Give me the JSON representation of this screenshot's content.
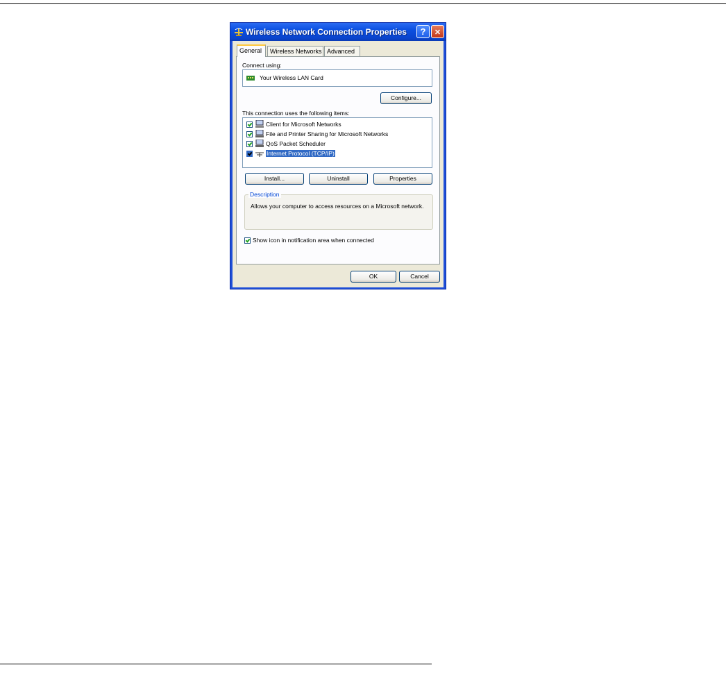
{
  "window": {
    "title": "Wireless Network Connection Properties",
    "help_glyph": "?",
    "close_glyph": "✕"
  },
  "tabs": [
    {
      "label": "General",
      "active": true
    },
    {
      "label": "Wireless Networks",
      "active": false
    },
    {
      "label": "Advanced",
      "active": false
    }
  ],
  "general": {
    "connect_using_label": "Connect using:",
    "adapter_name": "Your Wireless LAN Card",
    "configure_label": "Configure...",
    "items_label": "This connection uses the following items:",
    "items": [
      {
        "label": "Client for Microsoft Networks",
        "checked": true,
        "icon": "network-client-icon"
      },
      {
        "label": "File and Printer Sharing for Microsoft Networks",
        "checked": true,
        "icon": "network-service-icon"
      },
      {
        "label": "QoS Packet Scheduler",
        "checked": true,
        "icon": "network-service-icon"
      },
      {
        "label": "Internet Protocol (TCP/IP)",
        "checked": true,
        "selected": true,
        "icon": "protocol-icon"
      }
    ],
    "install_label": "Install...",
    "uninstall_label": "Uninstall",
    "properties_label": "Properties",
    "description_legend": "Description",
    "description_text": "Allows your computer to access resources on a Microsoft network.",
    "show_icon_label": "Show icon in notification area when connected",
    "show_icon_checked": true
  },
  "footer": {
    "ok_label": "OK",
    "cancel_label": "Cancel"
  },
  "colors": {
    "titlebar": "#0b4fe0",
    "dialog_face": "#ece9d8",
    "selection": "#316ac5"
  }
}
